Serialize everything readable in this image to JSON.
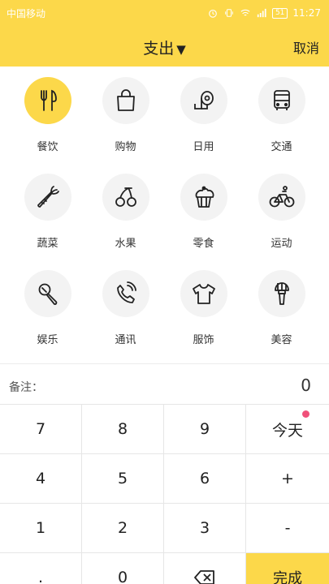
{
  "statusbar": {
    "carrier": "中国移动",
    "time": "11:27",
    "battery": "51"
  },
  "header": {
    "title": "支出",
    "title_arrow": "▼",
    "cancel_label": "取消"
  },
  "categories": [
    {
      "label": "餐饮",
      "icon": "fork-knife-icon",
      "active": true
    },
    {
      "label": "购物",
      "icon": "shopping-bag-icon"
    },
    {
      "label": "日用",
      "icon": "toilet-paper-icon"
    },
    {
      "label": "交通",
      "icon": "bus-icon"
    },
    {
      "label": "蔬菜",
      "icon": "carrot-icon"
    },
    {
      "label": "水果",
      "icon": "cherry-icon"
    },
    {
      "label": "零食",
      "icon": "cupcake-icon"
    },
    {
      "label": "运动",
      "icon": "bicycle-icon"
    },
    {
      "label": "娱乐",
      "icon": "microphone-icon"
    },
    {
      "label": "通讯",
      "icon": "phone-icon"
    },
    {
      "label": "服饰",
      "icon": "tshirt-icon"
    },
    {
      "label": "美容",
      "icon": "makeup-brush-icon"
    }
  ],
  "note": {
    "label": "备注：",
    "amount": "0"
  },
  "keypad": {
    "k7": "7",
    "k8": "8",
    "k9": "9",
    "today": "今天",
    "k4": "4",
    "k5": "5",
    "k6": "6",
    "plus": "+",
    "k1": "1",
    "k2": "2",
    "k3": "3",
    "minus": "-",
    "dot": ".",
    "k0": "0",
    "backspace_icon": "backspace-icon",
    "done": "完成"
  },
  "colors": {
    "accent": "#fcd84a",
    "badge": "#f0517a"
  }
}
